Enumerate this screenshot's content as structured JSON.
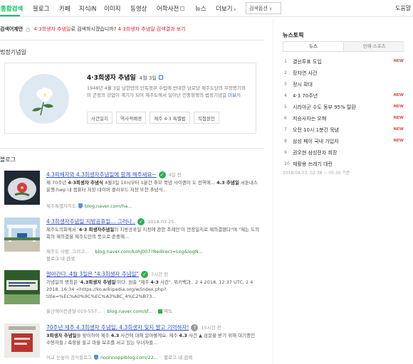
{
  "tabs": [
    {
      "label": "통합검색",
      "active": true
    },
    {
      "label": "블로그"
    },
    {
      "label": "카페"
    },
    {
      "label": "지식iN"
    },
    {
      "label": "이미지"
    },
    {
      "label": "동영상"
    },
    {
      "label": "어학사전"
    },
    {
      "label": "뉴스"
    },
    {
      "label": "더보기"
    }
  ],
  "search_option": "검색옵션",
  "help": "도움말",
  "correction": {
    "label": "검색어제안",
    "query": "4·3희생자 추념일",
    "mid": "로 검색하시겠습니까?",
    "link": "4·3희생자 추념일 검색결과 보기"
  },
  "sections": {
    "legal": "법정기념일",
    "blog": "블로그"
  },
  "card": {
    "title": "4·3희생자 추념일",
    "date": "4월 3일",
    "desc": "1948년 4월 3일 남한만의 단독정부 수립에 반대한 남로당 제주도당의 무장봉기와 미 군정의 강압이 계기가 되어 제주도에서 일어난 민중항쟁의 법정기념일",
    "more": "더보기",
    "tags": [
      "사건일지",
      "역사적배경",
      "제주 4·3 특별법",
      "직접원인"
    ]
  },
  "blogs": [
    {
      "title": "4.3피해자와 4.3희생자추념일에 함께 해주세요~",
      "date": "4일 전",
      "check": "green",
      "desc_html": "제 70주년 <b>4·3희생자 추념식</b> 4월3일 10시부터 1분간 추모 묵념 사이렌이 도 전역에... <b>4.3 추념일</b> 서툰내스 운행.hwp 내 컴퓨터 저장 네이버 클라우드 저장 또한 추념식...",
      "src": "제주특별자치도",
      "url": "blog.naver.com/ha...",
      "extra": ""
    },
    {
      "title": "4·3희생자추념일 지방공휴일... 그러나..",
      "date": "2018.03.25.",
      "check": "green",
      "desc_html": "제주도의회에서 '<b>4·3 희생자추념일</b>의 지방공휴일 지정에 관한 조례안'이 만장일치로 제의결됐다\"며 \"제는 도의회의 재의결을 제주도민의 뜻으로 존중해...",
      "src": "제주도 사람, 그리고...",
      "url": "blog.naver.com/kohj007?Redirect=Log&logN...",
      "extra": "블로그 내 검색"
    },
    {
      "title": "알아간다. 4월 3일은 \"4.3희생자 추념일\"",
      "date": "7시간 전",
      "check": "green",
      "desc_html": "기념일의 명칭은 '<b>4.3희생자 추념일</b>'이다. 원출 \"제주 <b>4·3</b> 사건\". 위키백과.. 2 4 2018, 12:37 UTC, 2 4 2018, 16:34 &lt;https://ko.wikipedia.org/w/index.php?title=%EC%A0%9C%EC%A3%BC_4%C2%B73...",
      "src": "울산에어컨렌탈 010-557...",
      "url": "blog.naver.com/sf...",
      "extra": "약도"
    },
    {
      "title": "70주년 제주 4.3희생자 추념일, 4.3희생자 잊지 말고 기억하자!",
      "date": "15시간 전",
      "check": "grey",
      "desc_html": "<b>3희생자 추념일</b>을 맞이하여 제주 <b>4.3</b> 사건에 대해 알아볼게요. 제주 <b>4.3</b> 사건 ▲ 삼문을 받기 위해 대기중인 수용자들 / 축항을 들고 마을 보초를 서고 있는 부녀자들...",
      "src": "어교 눈높이 공식블로그",
      "url": "noonnoppiblog.com/22...",
      "extra": "블로그 내 검색"
    }
  ],
  "rail": {
    "title": "뉴스토픽",
    "tabs": [
      "뉴스",
      "연예·스포츠"
    ],
    "items": [
      {
        "rank": "1",
        "text": "결선투표 도입",
        "new": "NEW"
      },
      {
        "rank": "2",
        "text": "장자연 사건",
        "new": ""
      },
      {
        "rank": "3",
        "text": "정시 확대",
        "new": ""
      },
      {
        "rank": "4",
        "text": "4·3 70주년",
        "new": "NEW"
      },
      {
        "rank": "5",
        "text": "시리아군 수도 동부 95% 탈환",
        "new": "NEW"
      },
      {
        "rank": "6",
        "text": "저승사자는 오해",
        "new": "NEW"
      },
      {
        "rank": "7",
        "text": "오전 10시 1분간 묵념",
        "new": "NEW"
      },
      {
        "rank": "8",
        "text": "삼성 페이 국내 가입자",
        "new": "NEW"
      },
      {
        "rank": "9",
        "text": "권오현 삼성전자 회장",
        "new": ""
      },
      {
        "rank": "10",
        "text": "재활용 쓰레기 대란",
        "new": ""
      }
    ],
    "time": "2018.04.03. 02:38 ~ 05:30 기준"
  },
  "colors": {
    "accent": "#03c75a",
    "link": "#2b4fc9",
    "alert": "#d7263d",
    "new": "#e04d4d"
  }
}
